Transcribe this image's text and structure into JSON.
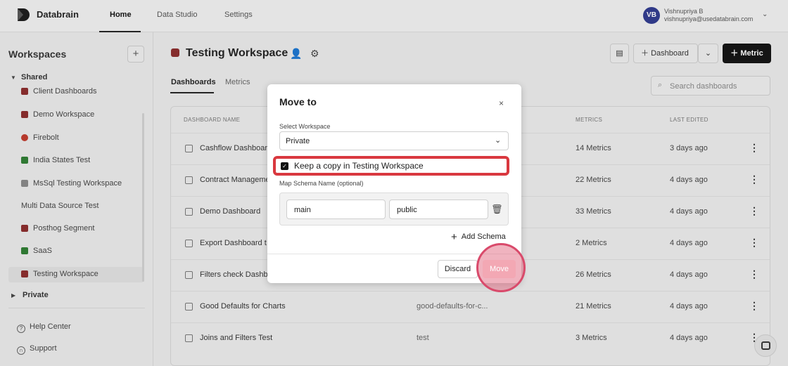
{
  "brand": {
    "name": "Databrain"
  },
  "nav": [
    {
      "label": "Home",
      "active": true
    },
    {
      "label": "Data Studio",
      "active": false
    },
    {
      "label": "Settings",
      "active": false
    }
  ],
  "user": {
    "initials": "VB",
    "name": "Vishnupriya B",
    "email": "vishnupriya@usedatabrain.com"
  },
  "sidebar": {
    "title": "Workspaces",
    "groups": {
      "shared": "Shared",
      "private": "Private"
    },
    "items": [
      {
        "label": "Client Dashboards",
        "color": "#8b2b2b"
      },
      {
        "label": "Demo Workspace",
        "color": "#8b2b2b"
      },
      {
        "label": "Firebolt",
        "color": "#c0392b"
      },
      {
        "label": "India States Test",
        "color": "#2e7d32"
      },
      {
        "label": "MsSql Testing Workspace",
        "color": "#888888"
      },
      {
        "label": "Multi Data Source Test",
        "color": ""
      },
      {
        "label": "Posthog Segment",
        "color": "#8b2b2b"
      },
      {
        "label": "SaaS",
        "color": "#2e7d32"
      },
      {
        "label": "Testing Workspace",
        "color": "#8b2b2b"
      }
    ],
    "help": "Help Center",
    "support": "Support"
  },
  "header": {
    "title": "Testing Workspace",
    "dashboard_btn": "Dashboard",
    "metric_btn": "Metric",
    "tabs": [
      "Dashboards",
      "Metrics"
    ],
    "search_placeholder": "Search dashboards"
  },
  "table": {
    "columns": [
      "DASHBOARD NAME",
      "METRICS",
      "LAST EDITED"
    ],
    "rows": [
      {
        "name": "Cashflow Dashboard",
        "slug": "",
        "metrics": "14 Metrics",
        "edited": "3 days ago"
      },
      {
        "name": "Contract Manageme",
        "slug": "",
        "metrics": "22 Metrics",
        "edited": "4 days ago"
      },
      {
        "name": "Demo Dashboard",
        "slug": "",
        "metrics": "33 Metrics",
        "edited": "4 days ago"
      },
      {
        "name": "Export Dashboard t",
        "slug": "",
        "metrics": "2 Metrics",
        "edited": "4 days ago"
      },
      {
        "name": "Filters check Dashb",
        "slug": "",
        "metrics": "26 Metrics",
        "edited": "4 days ago"
      },
      {
        "name": "Good Defaults for Charts",
        "slug": "good-defaults-for-c...",
        "metrics": "21 Metrics",
        "edited": "4 days ago"
      },
      {
        "name": "Joins and Filters Test",
        "slug": "test",
        "metrics": "3 Metrics",
        "edited": "4 days ago"
      }
    ]
  },
  "modal": {
    "title": "Move to",
    "close_icon": "×",
    "select_label": "Select Workspace",
    "select_value": "Private",
    "checkbox_label": "Keep a copy in Testing Workspace",
    "checkbox_checked": true,
    "schema_label": "Map Schema Name (optional)",
    "schema_from": "main",
    "schema_to": "public",
    "add_schema": "Add Schema",
    "discard": "Discard",
    "move": "Move"
  }
}
